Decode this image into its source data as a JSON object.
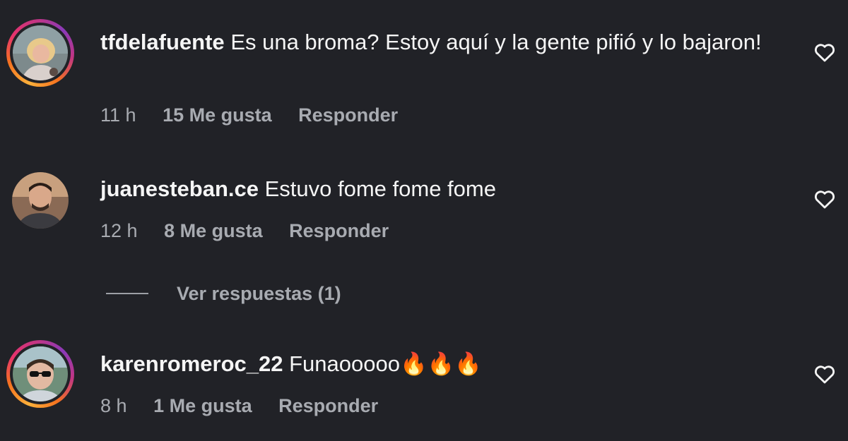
{
  "comments": [
    {
      "username": "tfdelafuente",
      "text": "Es una broma? Estoy aquí y la gente pifió y lo bajaron!",
      "time": "11 h",
      "likes": "15 Me gusta",
      "reply": "Responder",
      "has_story_ring": true
    },
    {
      "username": "juanesteban.ce",
      "text": "Estuvo fome fome fome",
      "time": "12 h",
      "likes": "8 Me gusta",
      "reply": "Responder",
      "has_story_ring": false
    },
    {
      "username": "karenromeroc_22",
      "text": "Funaooooo🔥🔥🔥",
      "time": "8 h",
      "likes": "1 Me gusta",
      "reply": "Responder",
      "has_story_ring": true
    }
  ],
  "view_replies": "Ver respuestas (1)",
  "colors": {
    "background": "#212227",
    "text": "#f5f5f5",
    "muted": "#a8abb1"
  },
  "icons": {
    "like": "heart-outline-icon"
  }
}
